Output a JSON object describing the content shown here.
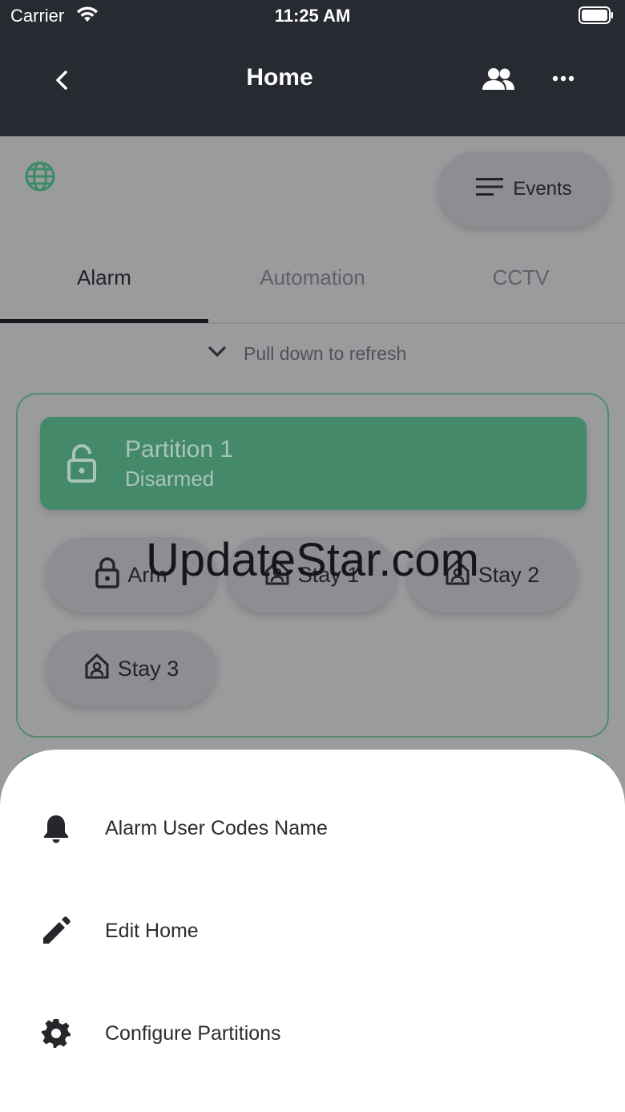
{
  "status_bar": {
    "carrier": "Carrier",
    "time": "11:25 AM"
  },
  "app_bar": {
    "title": "Home"
  },
  "toolbar": {
    "events_label": "Events"
  },
  "tabs": [
    {
      "label": "Alarm",
      "active": true
    },
    {
      "label": "Automation",
      "active": false
    },
    {
      "label": "CCTV",
      "active": false
    }
  ],
  "refresh_hint": "Pull down to refresh",
  "partition": {
    "name": "Partition 1",
    "state": "Disarmed",
    "buttons": [
      {
        "label": "Arm",
        "icon": "lock-icon"
      },
      {
        "label": "Stay 1",
        "icon": "home-user-icon"
      },
      {
        "label": "Stay 2",
        "icon": "home-user-icon"
      },
      {
        "label": "Stay 3",
        "icon": "home-user-icon"
      }
    ]
  },
  "watermark": "UpdateStar.com",
  "sheet": {
    "items": [
      {
        "label": "Alarm User Codes Name",
        "icon": "bell-icon"
      },
      {
        "label": "Edit Home",
        "icon": "pencil-icon"
      },
      {
        "label": "Configure Partitions",
        "icon": "gear-icon"
      }
    ]
  },
  "colors": {
    "app_bar": "#272a31",
    "accent_green": "#44896a",
    "dim_background": "#9a9b9d",
    "sheet": "#ffffff"
  }
}
